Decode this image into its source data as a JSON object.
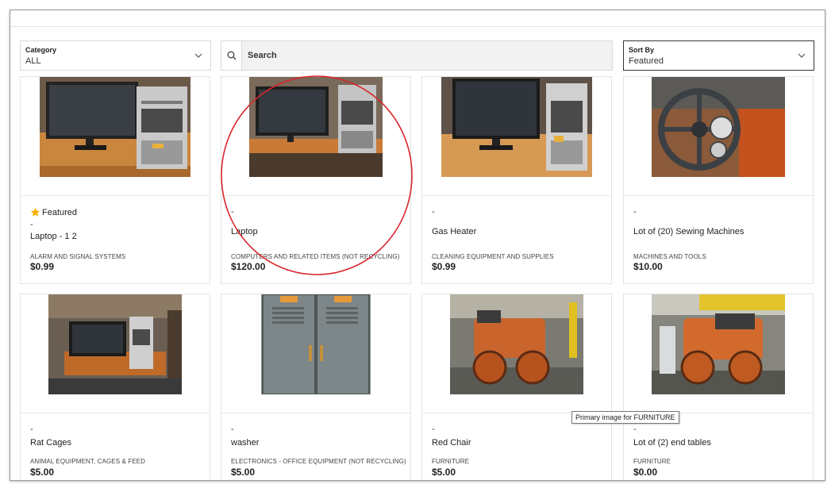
{
  "filters": {
    "category_label": "Category",
    "category_value": "ALL",
    "search_placeholder": "Search",
    "sort_label": "Sort By",
    "sort_value": "Featured"
  },
  "featured_badge": "Featured",
  "products": [
    {
      "dash": "-",
      "title": "Laptop - 1 2",
      "category": "ALARM AND SIGNAL SYSTEMS",
      "price": "$0.99",
      "featured": true,
      "image": "computer-desk-photo"
    },
    {
      "dash": "-",
      "title": "Laptop",
      "category": "COMPUTERS AND RELATED ITEMS (NOT RECYCLING)",
      "price": "$120.00",
      "featured": false,
      "image": "computer-desk-photo"
    },
    {
      "dash": "-",
      "title": "Gas Heater",
      "category": "CLEANING EQUIPMENT AND SUPPLIES",
      "price": "$0.99",
      "featured": false,
      "image": "computer-desk-photo"
    },
    {
      "dash": "-",
      "title": "Lot of (20) Sewing Machines",
      "category": "MACHINES AND TOOLS",
      "price": "$10.00",
      "featured": false,
      "image": "machine-steering-photo"
    },
    {
      "dash": "-",
      "title": "Rat Cages",
      "category": "ANIMAL EQUIPMENT, CAGES & FEED",
      "price": "$5.00",
      "featured": false,
      "image": "computer-desk-photo"
    },
    {
      "dash": "-",
      "title": "washer",
      "category": "ELECTRONICS - OFFICE EQUIPMENT (NOT RECYCLING)",
      "price": "$5.00",
      "featured": false,
      "image": "lockers-photo"
    },
    {
      "dash": "-",
      "title": "Red Chair",
      "category": "FURNITURE",
      "price": "$5.00",
      "featured": false,
      "image": "compactor-photo"
    },
    {
      "dash": "-",
      "title": "Lot of (2) end tables",
      "category": "FURNITURE",
      "price": "$0.00",
      "featured": false,
      "image": "compactor-photo"
    }
  ],
  "tooltip": "Primary image for FURNITURE",
  "colors": {
    "annotation_circle": "#d9262b",
    "star": "#f5b301"
  }
}
